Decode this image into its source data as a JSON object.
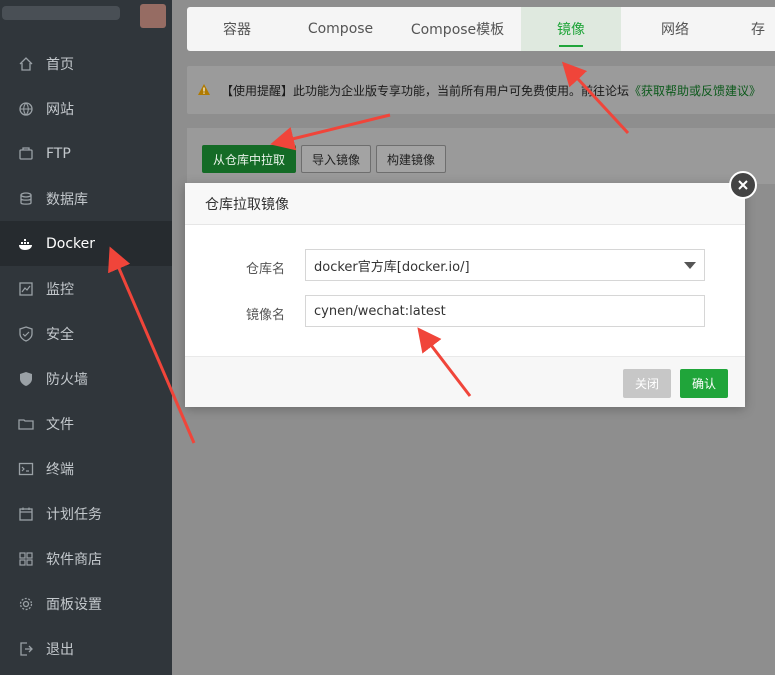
{
  "sidebar": {
    "items": [
      {
        "label": "首页",
        "icon": "home-icon"
      },
      {
        "label": "网站",
        "icon": "globe-icon"
      },
      {
        "label": "FTP",
        "icon": "ftp-icon"
      },
      {
        "label": "数据库",
        "icon": "database-icon"
      },
      {
        "label": "Docker",
        "icon": "docker-icon"
      },
      {
        "label": "监控",
        "icon": "monitor-icon"
      },
      {
        "label": "安全",
        "icon": "shield-icon"
      },
      {
        "label": "防火墙",
        "icon": "firewall-icon"
      },
      {
        "label": "文件",
        "icon": "folder-icon"
      },
      {
        "label": "终端",
        "icon": "terminal-icon"
      },
      {
        "label": "计划任务",
        "icon": "calendar-icon"
      },
      {
        "label": "软件商店",
        "icon": "grid-icon"
      },
      {
        "label": "面板设置",
        "icon": "gear-icon"
      },
      {
        "label": "退出",
        "icon": "logout-icon"
      }
    ],
    "active_index": 4
  },
  "tabs": [
    {
      "label": "容器"
    },
    {
      "label": "Compose"
    },
    {
      "label": "Compose模板"
    },
    {
      "label": "镜像"
    },
    {
      "label": "网络"
    },
    {
      "label": "存"
    }
  ],
  "notice": {
    "text": "【使用提醒】此功能为企业版专享功能，当前所有用户可免费使用。前往论坛",
    "link": "《获取帮助或反馈建议》"
  },
  "toolbar": {
    "pull_label": "从仓库中拉取",
    "import_label": "导入镜像",
    "build_label": "构建镜像"
  },
  "modal": {
    "title": "仓库拉取镜像",
    "repo_label": "仓库名",
    "repo_value": "docker官方库[docker.io/]",
    "image_label": "镜像名",
    "image_value": "cynen/wechat:latest",
    "close_label": "关闭",
    "ok_label": "确认"
  },
  "colors": {
    "accent": "#20a53a",
    "sidebar": "#30363b",
    "arrow": "#f0453a"
  }
}
